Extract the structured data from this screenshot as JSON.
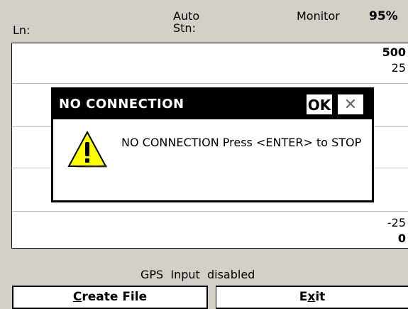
{
  "header": {
    "line_label": "Ln:",
    "mode_line1": "Auto",
    "mode_line2": "Stn:",
    "monitor_label": "Monitor",
    "battery_percent": "95%"
  },
  "plot": {
    "y_top_max": "500",
    "y_top_tick": "25",
    "y_bottom_tick": "-25",
    "y_bottom_min": "0"
  },
  "dialog": {
    "title": "NO CONNECTION",
    "ok_label": "OK",
    "close_symbol": "✕",
    "message": "NO CONNECTION Press <ENTER> to STOP",
    "icon": "warning-icon"
  },
  "footer": {
    "status": "GPS  Input  disabled",
    "create_file_prefix": "C",
    "create_file_rest": "reate File",
    "exit_prefix": "E",
    "exit_ul": "x",
    "exit_rest": "it"
  },
  "colors": {
    "background": "#d4d0c8",
    "dialog_title_bg": "#000000",
    "warning_fill": "#ffff00"
  }
}
